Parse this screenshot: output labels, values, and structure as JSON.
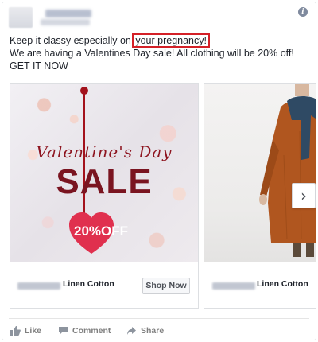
{
  "header": {
    "page_name": "",
    "info_icon_glyph": "i"
  },
  "post": {
    "text_before": "Keep it classy especially on ",
    "highlighted": "your pregnancy!",
    "line2": "We are having a Valentines Day sale! All clothing will be 20% off! GET IT NOW"
  },
  "carousel": {
    "card1": {
      "image_script_text": "Valentine's Day",
      "image_sale_text": "SALE",
      "image_badge": "20%OFF",
      "title": "Linen Cotton",
      "button": "Shop Now"
    },
    "card2": {
      "title": "Linen Cotton"
    },
    "next_glyph": "›"
  },
  "actions": {
    "like": "Like",
    "comment": "Comment",
    "share": "Share"
  },
  "colors": {
    "highlight_border": "#d42027",
    "sale_text": "#7a1420",
    "heart": "#e0304e",
    "action_gray": "#7f7f7f"
  }
}
